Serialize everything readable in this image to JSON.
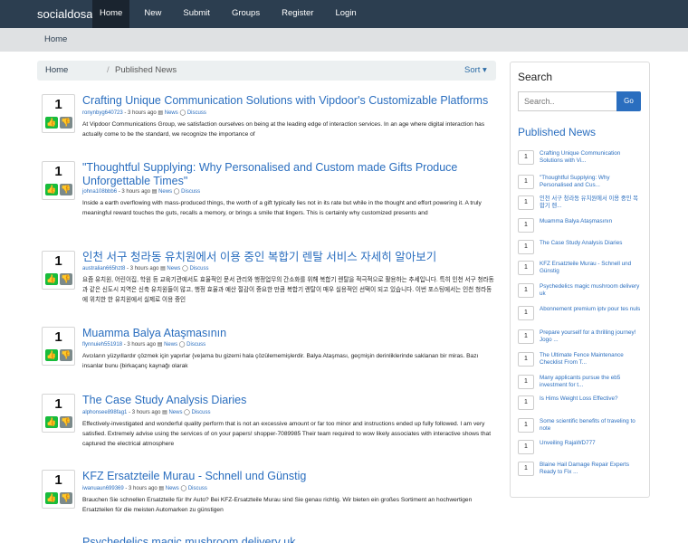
{
  "navbar": {
    "brand": "socialdosa",
    "links": [
      "Home",
      "New",
      "Submit",
      "Groups",
      "Register",
      "Login"
    ]
  },
  "subbar": {
    "home": "Home"
  },
  "breadcrumb": {
    "home": "Home",
    "separator": "/",
    "current": "Published News",
    "sort": "Sort ▾"
  },
  "posts": [
    {
      "votes": "1",
      "title": "Crafting Unique Communication Solutions with Vipdoor's Customizable Platforms",
      "user": "ronynbyg640723",
      "time": "- 3 hours ago",
      "category": "News",
      "discuss": "Discuss",
      "body": "At Vipdoor Communications Group, we satisfaction ourselves on being at the leading edge of interaction services. In an age where digital interaction has actually come to be the standard, we recognize the importance of"
    },
    {
      "votes": "1",
      "title": "\"Thoughtful Supplying: Why Personalised and Custom made Gifts Produce Unforgettable Times\"",
      "user": "johna108bbb6",
      "time": "- 3 hours ago",
      "category": "News",
      "discuss": "Discuss",
      "body": "Inside a earth overflowing with mass-produced things, the worth of a gift typically lies not in its rate but while in the thought and effort powering it. A truly meaningful reward touches the guts, recalls a memory, or brings a smile that lingers. This is certainly why customized presents and"
    },
    {
      "votes": "1",
      "title": "인천 서구 청라동 유치원에서 이용 중인 복합기 렌탈 서비스 자세히 알아보기",
      "user": "australian665hzt8",
      "time": "- 3 hours ago",
      "category": "News",
      "discuss": "Discuss",
      "body": "요즘 유치원, 어린이집, 학원 등 교육기관에서도 효율적인 문서 관리와 행정업무의 간소화를 위해 복합기 렌탈을 적극적으로 활용하는 추세입니다. 특히 인천 서구 청라동과 같은 신도시 지역은 신축 유치원들이 많고, 행정 효율과 예산 절감이 중요한 만큼 복합기 렌탈이 매우 실용적인 선택이 되고 있습니다. 이번 포스팅에서는 인천 청라동에 위치한 한 유치원에서 실제로 이용 중인"
    },
    {
      "votes": "1",
      "title": "Muamma Balya Ataşmasının",
      "user": "flynnuieh551918",
      "time": "- 3 hours ago",
      "category": "News",
      "discuss": "Discuss",
      "body": "Avcıların yüzyıllardır çözmek için yapırlar {ve|ama bu gizemi hala çözülememişlerdir. Balya Ataşması, geçmişin derinliklerinde saklanan bir miras. Bazı insanlar bunu {birkaçanç kaynağı olarak"
    },
    {
      "votes": "1",
      "title": "The Case Study Analysis Diaries",
      "user": "alphonsee898fag1",
      "time": "- 3 hours ago",
      "category": "News",
      "discuss": "Discuss",
      "body": "Effectively-investigated and wonderful quality perform that is not an excessive amount or far too minor and instructions ended up fully followed. I am very satisfied. Extremely advise using the services of on your papers! shopper-7089985 Their team required to wow likely associates with interactive shows that captured the electrical atmosphere"
    },
    {
      "votes": "1",
      "title": "KFZ Ersatzteile Murau - Schnell und Günstig",
      "user": "iwanuaun699369",
      "time": "- 3 hours ago",
      "category": "News",
      "discuss": "Discuss",
      "body": "Brauchen Sie schnellen Ersatzteile für Ihr Auto? Bei KFZ-Ersatzteile Murau sind Sie genau richtig. Wir bieten ein großes Sortiment an hochwertigen Ersatzteilen für die meisten Automarken zu günstigen"
    },
    {
      "votes": "",
      "title": "Psychedelics magic mushroom delivery uk",
      "user": "",
      "time": "",
      "category": "",
      "discuss": "",
      "body": ""
    }
  ],
  "sidebar": {
    "search_title": "Search",
    "search_placeholder": "Search..",
    "search_button": "Go",
    "news_title": "Published News",
    "items": [
      {
        "count": "1",
        "title": "Crafting Unique Communication Solutions with Vi..."
      },
      {
        "count": "1",
        "title": "\"Thoughtful Supplying: Why Personalised and Cus..."
      },
      {
        "count": "1",
        "title": "인천 서구 청라동 유치원에서 이용 중인 복합기 렌..."
      },
      {
        "count": "1",
        "title": "Muamma Balya Ataşmasının"
      },
      {
        "count": "1",
        "title": "The Case Study Analysis Diaries"
      },
      {
        "count": "1",
        "title": "KFZ Ersatzteile Murau - Schnell und Günstig"
      },
      {
        "count": "1",
        "title": "Psychedelics magic mushroom delivery uk"
      },
      {
        "count": "1",
        "title": "Abonnement premium iptv pour tes nuls"
      },
      {
        "count": "1",
        "title": "Prepare yourself for a thrilling journey! Jogo ..."
      },
      {
        "count": "1",
        "title": "The Ultimate Fence Maintenance Checklist From T..."
      },
      {
        "count": "1",
        "title": "Many applicants pursue the eb5 investment for t..."
      },
      {
        "count": "1",
        "title": "Is Hims Weight Loss Effective?"
      },
      {
        "count": "1",
        "title": "Some scientific benefits of traveling to note"
      },
      {
        "count": "1",
        "title": "Unveiling RajaWD777"
      },
      {
        "count": "1",
        "title": "Blaine Hail Damage Repair Experts Ready to Fix ..."
      }
    ]
  },
  "colors": {
    "navbar": "#2c3e50",
    "link": "#2a6ebf",
    "vote_up": "#18bc3c",
    "vote_down": "#7b8a8b"
  }
}
